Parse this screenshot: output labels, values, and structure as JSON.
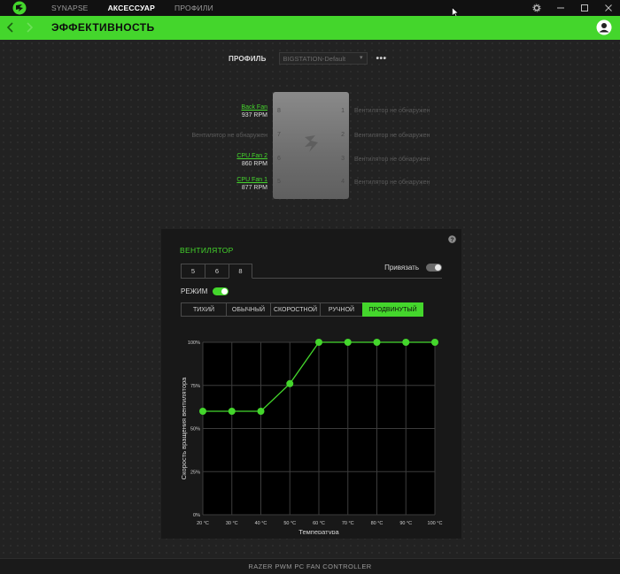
{
  "topbar": {
    "tabs": [
      {
        "label": "SYNAPSE",
        "active": false
      },
      {
        "label": "АКСЕССУАР",
        "active": true
      },
      {
        "label": "ПРОФИЛИ",
        "active": false
      }
    ],
    "icons": [
      "razer-logo-icon",
      "gear-icon",
      "minimize-icon",
      "maximize-icon",
      "close-icon"
    ]
  },
  "header": {
    "title": "ЭФФЕКТИВНОСТЬ",
    "accent": "#44d62c"
  },
  "profile": {
    "label": "ПРОФИЛЬ",
    "selected": "BIGSTATION-Default",
    "more": "•••"
  },
  "device": {
    "ports_left": [
      "8",
      "7",
      "6",
      "5"
    ],
    "ports_right": [
      "1",
      "2",
      "3",
      "4"
    ],
    "left_fans": [
      {
        "name": "Back Fan",
        "rpm": "937 RPM",
        "detected": true
      },
      {
        "name": "Вентилятор не обнаружен",
        "rpm": "",
        "detected": false
      },
      {
        "name": "CPU Fan 2",
        "rpm": "860 RPM",
        "detected": true
      },
      {
        "name": "CPU Fan 1",
        "rpm": "877 RPM",
        "detected": true
      }
    ],
    "right_fans": [
      {
        "name": "Вентилятор не обнаружен"
      },
      {
        "name": "Вентилятор не обнаружен"
      },
      {
        "name": "Вентилятор не обнаружен"
      },
      {
        "name": "Вентилятор не обнаружен"
      }
    ]
  },
  "fan_panel": {
    "title": "ВЕНТИЛЯТОР",
    "tabs": [
      "5",
      "6",
      "8"
    ],
    "active_tab": "8",
    "bind_label": "Привязать",
    "bind_on": false,
    "mode_label": "РЕЖИМ",
    "mode_on": true,
    "modes": [
      "ТИХИЙ",
      "ОБЫЧНЫЙ",
      "СКОРОСТНОЙ",
      "РУЧНОЙ",
      "ПРОДВИНУТЫЙ"
    ],
    "active_mode": "ПРОДВИНУТЫЙ"
  },
  "chart_data": {
    "type": "line",
    "x": [
      20,
      30,
      40,
      50,
      60,
      70,
      80,
      90,
      100
    ],
    "x_tick_labels": [
      "20 °C",
      "30 °C",
      "40 °C",
      "50 °C",
      "60 °C",
      "70 °C",
      "80 °C",
      "90 °C",
      "100 °C"
    ],
    "y_tick_labels": [
      "0%",
      "25%",
      "50%",
      "75%",
      "100%"
    ],
    "y_ticks": [
      0,
      25,
      50,
      75,
      100
    ],
    "series": [
      {
        "values": [
          60,
          60,
          60,
          76,
          100,
          100,
          100,
          100,
          100
        ],
        "color": "#44d62c"
      }
    ],
    "xlabel": "Температура",
    "ylabel": "Скорость вращения вентилятора",
    "xlim": [
      20,
      100
    ],
    "ylim": [
      0,
      100
    ],
    "grid": true
  },
  "footer": {
    "device_name": "RAZER PWM PC FAN CONTROLLER"
  }
}
